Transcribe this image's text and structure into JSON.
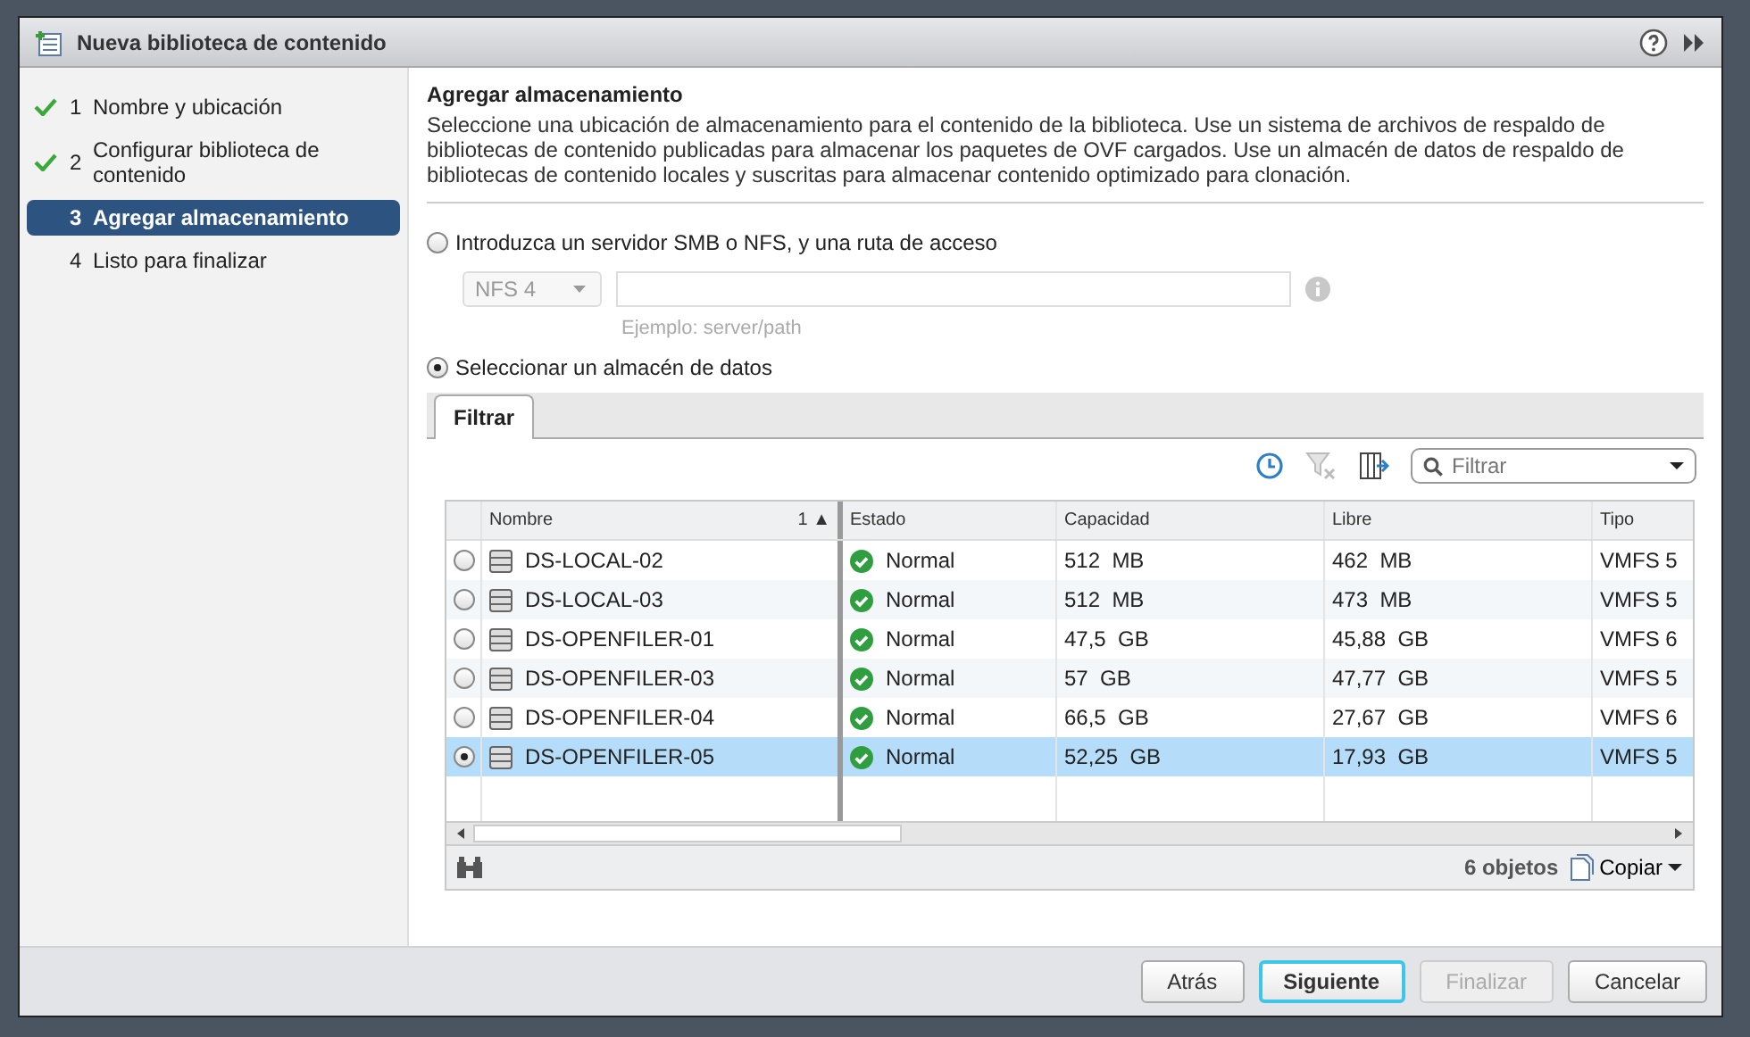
{
  "dialog": {
    "title": "Nueva biblioteca de contenido"
  },
  "steps": [
    {
      "number": "1",
      "label": "Nombre y ubicación",
      "completed": true,
      "selected": false
    },
    {
      "number": "2",
      "label": "Configurar biblioteca de contenido",
      "completed": true,
      "selected": false
    },
    {
      "number": "3",
      "label": "Agregar almacenamiento",
      "completed": false,
      "selected": true
    },
    {
      "number": "4",
      "label": "Listo para finalizar",
      "completed": false,
      "selected": false
    }
  ],
  "section": {
    "title": "Agregar almacenamiento",
    "description": "Seleccione una ubicación de almacenamiento para el contenido de la biblioteca. Use un sistema de archivos de respaldo de bibliotecas de contenido publicadas para almacenar los paquetes de OVF cargados. Use un almacén de datos de respaldo de bibliotecas de contenido locales y suscritas para almacenar contenido optimizado para clonación."
  },
  "options": [
    {
      "label": "Introduzca un servidor SMB o NFS, y una ruta de acceso",
      "selected": false
    },
    {
      "label": "Seleccionar un almacén de datos",
      "selected": true
    }
  ],
  "nfs": {
    "version": "NFS 4",
    "hint": "Ejemplo: server/path",
    "disabled": true
  },
  "tabs": [
    {
      "label": "Filtrar",
      "selected": true
    }
  ],
  "filter": {
    "placeholder": "Filtrar"
  },
  "table": {
    "columns": [
      {
        "label": "Nombre",
        "sort": "1 ▲"
      },
      {
        "label": "Estado"
      },
      {
        "label": "Capacidad"
      },
      {
        "label": "Libre"
      },
      {
        "label": "Tipo"
      }
    ],
    "rows": [
      {
        "name": "DS-LOCAL-02",
        "status": "Normal",
        "capacity": "512  MB",
        "free": "462  MB",
        "type": "VMFS 5",
        "selected": false
      },
      {
        "name": "DS-LOCAL-03",
        "status": "Normal",
        "capacity": "512  MB",
        "free": "473  MB",
        "type": "VMFS 5",
        "selected": false
      },
      {
        "name": "DS-OPENFILER-01",
        "status": "Normal",
        "capacity": "47,5  GB",
        "free": "45,88  GB",
        "type": "VMFS 6",
        "selected": false
      },
      {
        "name": "DS-OPENFILER-03",
        "status": "Normal",
        "capacity": "57  GB",
        "free": "47,77  GB",
        "type": "VMFS 5",
        "selected": false
      },
      {
        "name": "DS-OPENFILER-04",
        "status": "Normal",
        "capacity": "66,5  GB",
        "free": "27,67  GB",
        "type": "VMFS 6",
        "selected": false
      },
      {
        "name": "DS-OPENFILER-05",
        "status": "Normal",
        "capacity": "52,25  GB",
        "free": "17,93  GB",
        "type": "VMFS 5",
        "selected": true
      }
    ]
  },
  "table_footer": {
    "count": "6 objetos",
    "copy": "Copiar"
  },
  "buttons": [
    {
      "label": "Atrás",
      "kind": "normal"
    },
    {
      "label": "Siguiente",
      "kind": "primary"
    },
    {
      "label": "Finalizar",
      "kind": "disabled"
    },
    {
      "label": "Cancelar",
      "kind": "normal"
    }
  ]
}
